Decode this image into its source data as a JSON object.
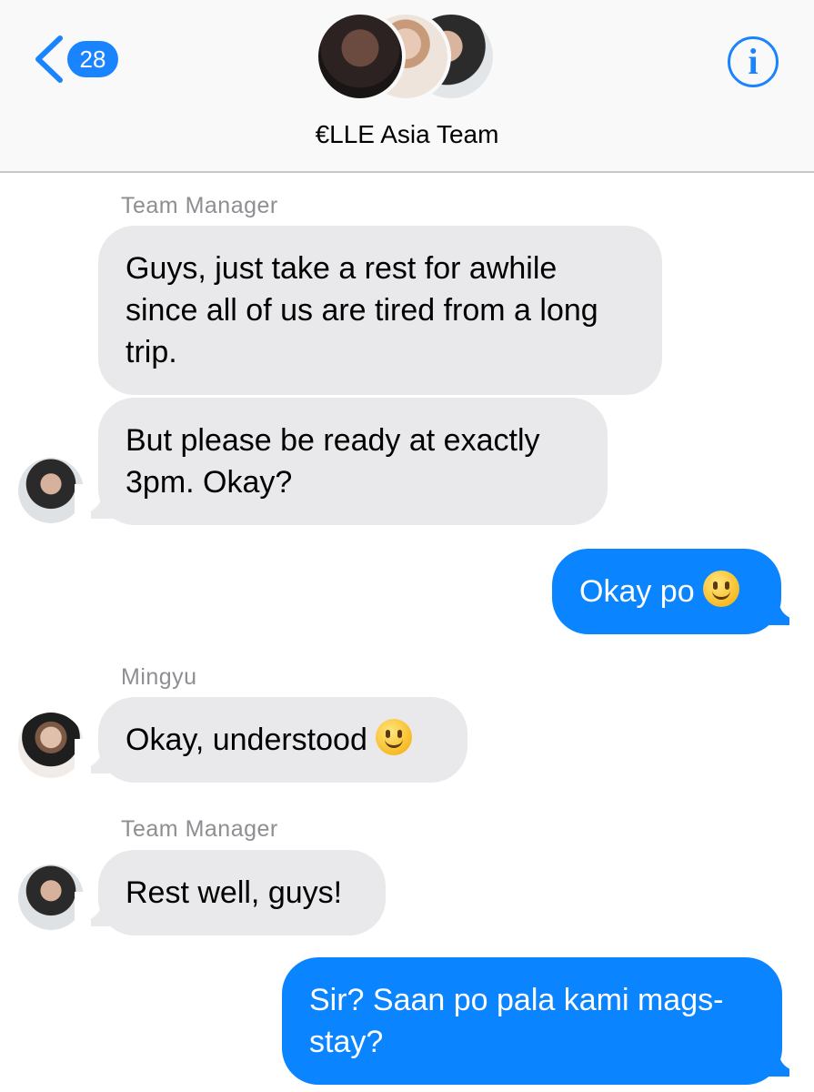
{
  "header": {
    "back_count": "28",
    "group_title": "€LLE Asia Team",
    "info_glyph": "i",
    "icons": [
      "chevron-left-icon",
      "info-icon"
    ],
    "accent_color": "#1a84ff"
  },
  "messages": [
    {
      "sender": "Team Manager",
      "text": "Guys, just take a rest for awhile since all of us are tired from a long trip.",
      "direction": "incoming"
    },
    {
      "text": "But please be ready at exactly 3pm. Okay?",
      "direction": "incoming"
    },
    {
      "text": "Okay po",
      "emoji": "slightly-smiling-face",
      "direction": "outgoing"
    },
    {
      "sender": "Mingyu",
      "text": "Okay, understood",
      "emoji": "slightly-smiling-face",
      "direction": "incoming"
    },
    {
      "sender": "Team Manager",
      "text": "Rest well, guys!",
      "direction": "incoming"
    },
    {
      "text": "Sir? Saan po pala kami mags-stay?",
      "direction": "outgoing"
    }
  ],
  "colors": {
    "incoming_bubble": "#e9e9eb",
    "outgoing_bubble": "#0a84ff",
    "sender_label": "#8e8e93"
  }
}
